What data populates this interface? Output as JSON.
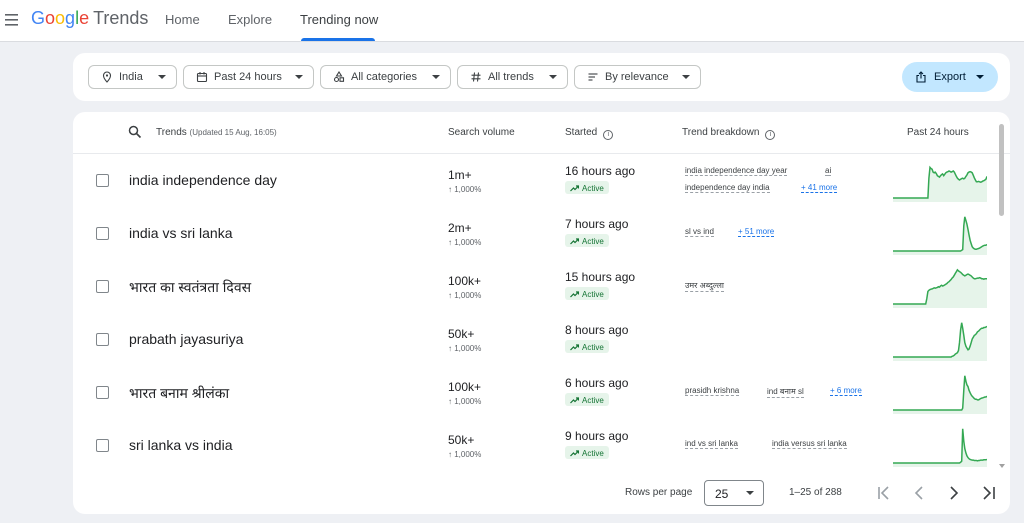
{
  "header": {
    "logo_google": [
      "G",
      "o",
      "o",
      "g",
      "l",
      "e"
    ],
    "logo_trends": "Trends",
    "nav": [
      {
        "label": "Home"
      },
      {
        "label": "Explore"
      },
      {
        "label": "Trending now"
      }
    ],
    "active_tab": "Trending now"
  },
  "filters": {
    "location": "India",
    "time": "Past 24 hours",
    "category": "All categories",
    "trend_type": "All trends",
    "sort": "By relevance",
    "export_label": "Export"
  },
  "table": {
    "headers": {
      "trends": "Trends",
      "updated": "(Updated 15 Aug, 16:05)",
      "search_volume": "Search volume",
      "started": "Started",
      "breakdown": "Trend breakdown",
      "past": "Past 24 hours"
    },
    "rows": [
      {
        "name": "india independence day",
        "volume": "1m+",
        "volume_change": "↑ 1,000%",
        "started": "16 hours ago",
        "status": "Active",
        "breakdown_line1": [
          "india independence day year",
          "ai"
        ],
        "breakdown_line2": [
          "independence day india"
        ],
        "more": "+ 41 more",
        "spark": [
          0,
          0,
          0,
          0,
          0,
          0,
          0,
          0,
          0,
          0,
          0,
          0,
          0,
          0,
          0,
          0,
          0,
          0,
          0,
          0,
          0,
          0,
          0,
          0,
          0,
          0,
          0,
          0,
          0,
          0,
          0,
          0,
          0,
          0,
          0.55,
          0.85,
          0.82,
          0.8,
          0.72,
          0.7,
          0.72,
          0.68,
          0.62,
          0.6,
          0.58,
          0.62,
          0.65,
          0.67,
          0.62,
          0.66,
          0.7,
          0.72,
          0.73,
          0.75,
          0.74,
          0.72,
          0.73,
          0.75,
          0.72,
          0.66,
          0.6,
          0.55,
          0.52,
          0.5,
          0.52,
          0.54,
          0.55,
          0.53,
          0.55,
          0.6,
          0.64,
          0.7,
          0.72,
          0.73,
          0.72,
          0.7,
          0.63,
          0.56,
          0.5,
          0.45,
          0.45,
          0.46,
          0.45,
          0.44,
          0.45,
          0.47,
          0.48,
          0.5,
          0.52,
          0.6
        ]
      },
      {
        "name": "india vs sri lanka",
        "volume": "2m+",
        "volume_change": "↑ 1,000%",
        "started": "7 hours ago",
        "status": "Active",
        "breakdown_line1": [
          "sl vs ind"
        ],
        "breakdown_line2": [],
        "more": "+ 51 more",
        "spark": [
          0,
          0,
          0,
          0,
          0,
          0,
          0,
          0,
          0,
          0,
          0,
          0,
          0,
          0,
          0,
          0,
          0,
          0,
          0,
          0,
          0,
          0,
          0,
          0,
          0,
          0,
          0,
          0,
          0,
          0,
          0,
          0,
          0,
          0,
          0,
          0,
          0,
          0,
          0,
          0,
          0,
          0,
          0,
          0,
          0,
          0,
          0,
          0,
          0,
          0,
          0,
          0,
          0,
          0,
          0,
          0,
          0,
          0,
          0,
          0,
          0,
          0,
          0,
          0,
          0,
          0.02,
          0.04,
          0.7,
          0.95,
          0.85,
          0.75,
          0.6,
          0.45,
          0.3,
          0.2,
          0.12,
          0.08,
          0.06,
          0.05,
          0.05,
          0.06,
          0.07,
          0.08,
          0.1,
          0.12,
          0.14,
          0.15,
          0.16,
          0.16,
          0.18
        ]
      },
      {
        "name": "भारत का स्वतंत्रता दिवस",
        "volume": "100k+",
        "volume_change": "↑ 1,000%",
        "started": "15 hours ago",
        "status": "Active",
        "breakdown_line1": [
          "उमर अब्दुल्ला"
        ],
        "breakdown_line2": [],
        "more": "",
        "spark": [
          0,
          0,
          0,
          0,
          0,
          0,
          0,
          0,
          0,
          0,
          0,
          0,
          0,
          0,
          0,
          0,
          0,
          0,
          0,
          0,
          0,
          0,
          0,
          0,
          0,
          0,
          0,
          0,
          0,
          0,
          0,
          0,
          0.15,
          0.35,
          0.38,
          0.4,
          0.41,
          0.42,
          0.43,
          0.45,
          0.44,
          0.45,
          0.46,
          0.48,
          0.47,
          0.5,
          0.52,
          0.5,
          0.51,
          0.53,
          0.55,
          0.57,
          0.6,
          0.62,
          0.65,
          0.68,
          0.72,
          0.75,
          0.8,
          0.85,
          0.9,
          0.95,
          0.92,
          0.9,
          0.88,
          0.85,
          0.82,
          0.8,
          0.78,
          0.8,
          0.82,
          0.83,
          0.82,
          0.8,
          0.78,
          0.75,
          0.72,
          0.7,
          0.7,
          0.71,
          0.72,
          0.72,
          0.73,
          0.72,
          0.7,
          0.7,
          0.69,
          0.7,
          0.7,
          0.7
        ]
      },
      {
        "name": "prabath jayasuriya",
        "volume": "50k+",
        "volume_change": "↑ 1,000%",
        "started": "8 hours ago",
        "status": "Active",
        "breakdown_line1": [],
        "breakdown_line2": [],
        "more": "",
        "spark": [
          0,
          0,
          0,
          0,
          0,
          0,
          0,
          0,
          0,
          0,
          0,
          0,
          0,
          0,
          0,
          0,
          0,
          0,
          0,
          0,
          0,
          0,
          0,
          0,
          0,
          0,
          0,
          0,
          0,
          0,
          0,
          0,
          0,
          0,
          0,
          0,
          0,
          0,
          0,
          0,
          0,
          0,
          0,
          0,
          0,
          0,
          0,
          0,
          0,
          0,
          0,
          0,
          0,
          0,
          0,
          0,
          0.02,
          0.03,
          0.05,
          0.08,
          0.1,
          0.12,
          0.18,
          0.4,
          0.75,
          0.95,
          0.8,
          0.6,
          0.4,
          0.3,
          0.25,
          0.2,
          0.22,
          0.3,
          0.4,
          0.5,
          0.55,
          0.6,
          0.62,
          0.65,
          0.7,
          0.72,
          0.75,
          0.78,
          0.8,
          0.8,
          0.82,
          0.82,
          0.83,
          0.85
        ]
      },
      {
        "name": "भारत बनाम श्रीलंका",
        "volume": "100k+",
        "volume_change": "↑ 1,000%",
        "started": "6 hours ago",
        "status": "Active",
        "breakdown_line1": [
          "prasidh krishna",
          "ind बनाम sl"
        ],
        "breakdown_line2": [],
        "more": "+ 6 more",
        "spark": [
          0,
          0,
          0,
          0,
          0,
          0,
          0,
          0,
          0,
          0,
          0,
          0,
          0,
          0,
          0,
          0,
          0,
          0,
          0,
          0,
          0,
          0,
          0,
          0,
          0,
          0,
          0,
          0,
          0,
          0,
          0,
          0,
          0,
          0,
          0,
          0,
          0,
          0,
          0,
          0,
          0,
          0,
          0,
          0,
          0,
          0,
          0,
          0,
          0,
          0,
          0,
          0,
          0,
          0,
          0,
          0,
          0,
          0,
          0,
          0,
          0,
          0,
          0,
          0,
          0,
          0,
          0.05,
          0.55,
          0.95,
          0.8,
          0.7,
          0.65,
          0.55,
          0.48,
          0.42,
          0.38,
          0.35,
          0.32,
          0.3,
          0.3,
          0.28,
          0.28,
          0.3,
          0.32,
          0.33,
          0.34,
          0.35,
          0.36,
          0.36,
          0.38
        ]
      },
      {
        "name": "sri lanka vs india",
        "volume": "50k+",
        "volume_change": "↑ 1,000%",
        "started": "9 hours ago",
        "status": "Active",
        "breakdown_line1": [
          "ind vs sri lanka",
          "india versus sri lanka"
        ],
        "breakdown_line2": [],
        "more": "",
        "spark": [
          0,
          0,
          0,
          0,
          0,
          0,
          0,
          0,
          0,
          0,
          0,
          0,
          0,
          0,
          0,
          0,
          0,
          0,
          0,
          0,
          0,
          0,
          0,
          0,
          0,
          0,
          0,
          0,
          0,
          0,
          0,
          0,
          0,
          0,
          0,
          0,
          0,
          0,
          0,
          0,
          0,
          0,
          0,
          0,
          0,
          0,
          0,
          0,
          0,
          0,
          0,
          0,
          0,
          0,
          0,
          0,
          0,
          0,
          0,
          0,
          0,
          0,
          0,
          0,
          0.02,
          0.05,
          0.95,
          0.6,
          0.4,
          0.28,
          0.2,
          0.15,
          0.12,
          0.1,
          0.09,
          0.08,
          0.08,
          0.07,
          0.07,
          0.07,
          0.06,
          0.07,
          0.07,
          0.08,
          0.08,
          0.08,
          0.09,
          0.09,
          0.09,
          0.1
        ]
      }
    ]
  },
  "pagination": {
    "rows_per_page_label": "Rows per page",
    "rows_per_page": "25",
    "range": "1–25 of 288"
  },
  "colors": {
    "accent": "#1a73e8",
    "spark_line": "#34a853",
    "active_badge_bg": "#e6f4ea",
    "active_badge_text": "#137333",
    "export_bg": "#c2e7ff"
  }
}
